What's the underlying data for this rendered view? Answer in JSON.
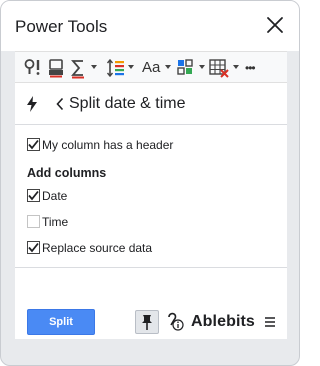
{
  "window": {
    "title": "Power Tools"
  },
  "toolbar": {
    "icons": [
      "find-replace-icon",
      "remove-icon",
      "sum-icon",
      "line-spacing-icon",
      "text-case-icon",
      "convert-icon",
      "clear-icon",
      "more-icon"
    ],
    "text_case_label": "Aa",
    "more_label": "•••"
  },
  "nav": {
    "title": "Split date & time"
  },
  "options": {
    "header": {
      "label": "My column has a header",
      "checked": true
    },
    "section_title": "Add columns",
    "date": {
      "label": "Date",
      "checked": true
    },
    "time": {
      "label": "Time",
      "checked": false
    },
    "replace": {
      "label": "Replace source data",
      "checked": true
    }
  },
  "footer": {
    "split_label": "Split",
    "brand": "Ablebits"
  },
  "colors": {
    "accent": "#4a8af4",
    "frame": "#e8eaed"
  }
}
